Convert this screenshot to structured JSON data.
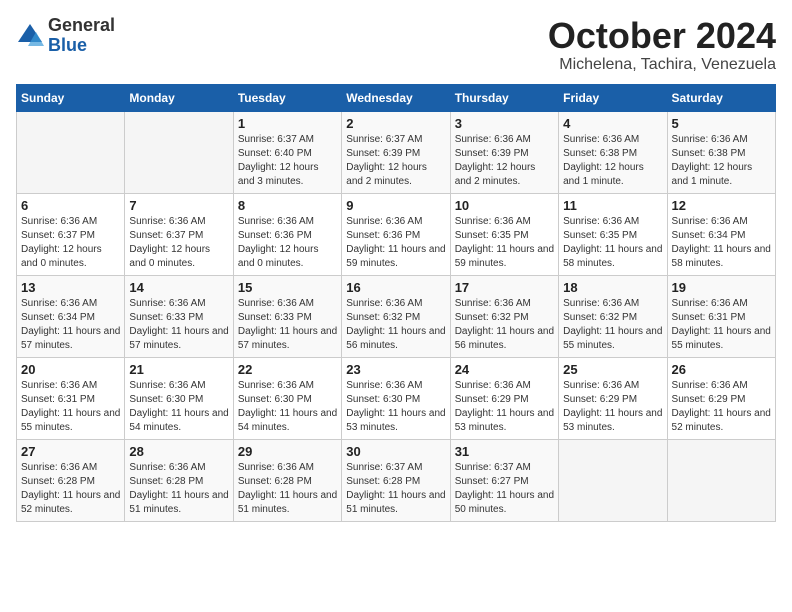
{
  "header": {
    "logo_general": "General",
    "logo_blue": "Blue",
    "month_title": "October 2024",
    "location": "Michelena, Tachira, Venezuela"
  },
  "days_of_week": [
    "Sunday",
    "Monday",
    "Tuesday",
    "Wednesday",
    "Thursday",
    "Friday",
    "Saturday"
  ],
  "weeks": [
    [
      {
        "day": "",
        "info": ""
      },
      {
        "day": "",
        "info": ""
      },
      {
        "day": "1",
        "info": "Sunrise: 6:37 AM\nSunset: 6:40 PM\nDaylight: 12 hours and 3 minutes."
      },
      {
        "day": "2",
        "info": "Sunrise: 6:37 AM\nSunset: 6:39 PM\nDaylight: 12 hours and 2 minutes."
      },
      {
        "day": "3",
        "info": "Sunrise: 6:36 AM\nSunset: 6:39 PM\nDaylight: 12 hours and 2 minutes."
      },
      {
        "day": "4",
        "info": "Sunrise: 6:36 AM\nSunset: 6:38 PM\nDaylight: 12 hours and 1 minute."
      },
      {
        "day": "5",
        "info": "Sunrise: 6:36 AM\nSunset: 6:38 PM\nDaylight: 12 hours and 1 minute."
      }
    ],
    [
      {
        "day": "6",
        "info": "Sunrise: 6:36 AM\nSunset: 6:37 PM\nDaylight: 12 hours and 0 minutes."
      },
      {
        "day": "7",
        "info": "Sunrise: 6:36 AM\nSunset: 6:37 PM\nDaylight: 12 hours and 0 minutes."
      },
      {
        "day": "8",
        "info": "Sunrise: 6:36 AM\nSunset: 6:36 PM\nDaylight: 12 hours and 0 minutes."
      },
      {
        "day": "9",
        "info": "Sunrise: 6:36 AM\nSunset: 6:36 PM\nDaylight: 11 hours and 59 minutes."
      },
      {
        "day": "10",
        "info": "Sunrise: 6:36 AM\nSunset: 6:35 PM\nDaylight: 11 hours and 59 minutes."
      },
      {
        "day": "11",
        "info": "Sunrise: 6:36 AM\nSunset: 6:35 PM\nDaylight: 11 hours and 58 minutes."
      },
      {
        "day": "12",
        "info": "Sunrise: 6:36 AM\nSunset: 6:34 PM\nDaylight: 11 hours and 58 minutes."
      }
    ],
    [
      {
        "day": "13",
        "info": "Sunrise: 6:36 AM\nSunset: 6:34 PM\nDaylight: 11 hours and 57 minutes."
      },
      {
        "day": "14",
        "info": "Sunrise: 6:36 AM\nSunset: 6:33 PM\nDaylight: 11 hours and 57 minutes."
      },
      {
        "day": "15",
        "info": "Sunrise: 6:36 AM\nSunset: 6:33 PM\nDaylight: 11 hours and 57 minutes."
      },
      {
        "day": "16",
        "info": "Sunrise: 6:36 AM\nSunset: 6:32 PM\nDaylight: 11 hours and 56 minutes."
      },
      {
        "day": "17",
        "info": "Sunrise: 6:36 AM\nSunset: 6:32 PM\nDaylight: 11 hours and 56 minutes."
      },
      {
        "day": "18",
        "info": "Sunrise: 6:36 AM\nSunset: 6:32 PM\nDaylight: 11 hours and 55 minutes."
      },
      {
        "day": "19",
        "info": "Sunrise: 6:36 AM\nSunset: 6:31 PM\nDaylight: 11 hours and 55 minutes."
      }
    ],
    [
      {
        "day": "20",
        "info": "Sunrise: 6:36 AM\nSunset: 6:31 PM\nDaylight: 11 hours and 55 minutes."
      },
      {
        "day": "21",
        "info": "Sunrise: 6:36 AM\nSunset: 6:30 PM\nDaylight: 11 hours and 54 minutes."
      },
      {
        "day": "22",
        "info": "Sunrise: 6:36 AM\nSunset: 6:30 PM\nDaylight: 11 hours and 54 minutes."
      },
      {
        "day": "23",
        "info": "Sunrise: 6:36 AM\nSunset: 6:30 PM\nDaylight: 11 hours and 53 minutes."
      },
      {
        "day": "24",
        "info": "Sunrise: 6:36 AM\nSunset: 6:29 PM\nDaylight: 11 hours and 53 minutes."
      },
      {
        "day": "25",
        "info": "Sunrise: 6:36 AM\nSunset: 6:29 PM\nDaylight: 11 hours and 53 minutes."
      },
      {
        "day": "26",
        "info": "Sunrise: 6:36 AM\nSunset: 6:29 PM\nDaylight: 11 hours and 52 minutes."
      }
    ],
    [
      {
        "day": "27",
        "info": "Sunrise: 6:36 AM\nSunset: 6:28 PM\nDaylight: 11 hours and 52 minutes."
      },
      {
        "day": "28",
        "info": "Sunrise: 6:36 AM\nSunset: 6:28 PM\nDaylight: 11 hours and 51 minutes."
      },
      {
        "day": "29",
        "info": "Sunrise: 6:36 AM\nSunset: 6:28 PM\nDaylight: 11 hours and 51 minutes."
      },
      {
        "day": "30",
        "info": "Sunrise: 6:37 AM\nSunset: 6:28 PM\nDaylight: 11 hours and 51 minutes."
      },
      {
        "day": "31",
        "info": "Sunrise: 6:37 AM\nSunset: 6:27 PM\nDaylight: 11 hours and 50 minutes."
      },
      {
        "day": "",
        "info": ""
      },
      {
        "day": "",
        "info": ""
      }
    ]
  ]
}
